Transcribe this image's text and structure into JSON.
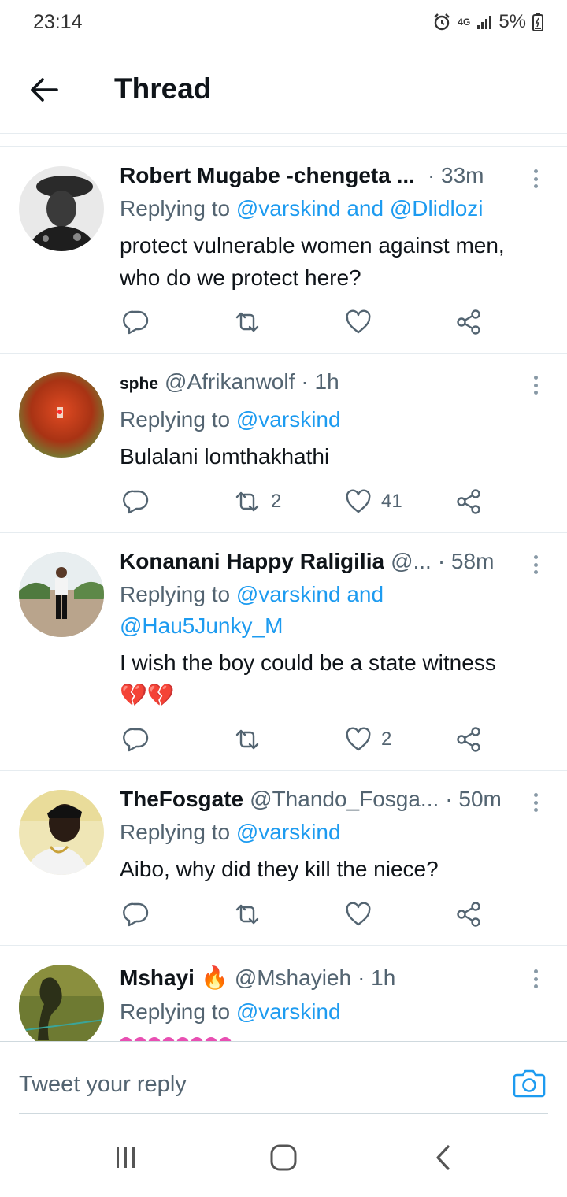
{
  "status_bar": {
    "time": "23:14",
    "network": "4G",
    "battery": "5%",
    "icons": [
      "alarm-icon",
      "signal-icon",
      "battery-icon"
    ]
  },
  "header": {
    "title": "Thread",
    "back_icon": "arrow-left-icon"
  },
  "colors": {
    "link": "#1d9bf0",
    "secondary_text": "#536471",
    "primary_text": "#0f1419",
    "divider": "#e6ecf0"
  },
  "tweets": [
    {
      "name": "Robert Mugabe -chengeta ...",
      "handle": "",
      "time": "· 33m",
      "replying_prefix": "Replying to",
      "mentions": "@varskind and @Dlidlozi",
      "body": "protect vulnerable women against men, who do we protect here?",
      "reply_count": "",
      "retweet_count": "",
      "like_count": ""
    },
    {
      "name": "sphe",
      "handle": "@Afrikanwolf",
      "time": "· 1h",
      "replying_prefix": "Replying to",
      "mentions": "@varskind",
      "body": "Bulalani lomthakhathi",
      "reply_count": "",
      "retweet_count": "2",
      "like_count": "41"
    },
    {
      "name": "Konanani Happy Raligilia",
      "handle": "@...",
      "time": "· 58m",
      "replying_prefix": "Replying to",
      "mentions": "@varskind and @Hau5Junky_M",
      "body": "I wish the boy could be a state witness",
      "body_emoji": "💔💔",
      "reply_count": "",
      "retweet_count": "",
      "like_count": "2"
    },
    {
      "name": "TheFosgate",
      "handle": "@Thando_Fosga...",
      "time": "· 50m",
      "replying_prefix": "Replying to",
      "mentions": "@varskind",
      "body": "Aibo, why did they kill the niece?",
      "reply_count": "",
      "retweet_count": "",
      "like_count": ""
    },
    {
      "name": "Mshayi",
      "name_emoji": "🔥",
      "handle": "@Mshayieh",
      "time": "· 1h",
      "replying_prefix": "Replying to",
      "mentions": "@varskind",
      "body": ""
    }
  ],
  "reply_bar": {
    "placeholder": "Tweet your reply",
    "camera_icon": "camera-icon"
  },
  "nav_bar": {
    "icons": [
      "recent-apps-icon",
      "home-icon",
      "back-icon"
    ]
  }
}
